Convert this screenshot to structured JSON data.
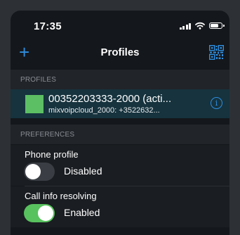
{
  "status_bar": {
    "time": "17:35"
  },
  "nav": {
    "title": "Profiles",
    "add_label": "+"
  },
  "profiles_section": {
    "header": "PROFILES",
    "items": [
      {
        "name": "00352203333-2000 (acti...",
        "subtitle": "mixvoipcloud_2000: +3522632...",
        "color": "#5cbf63",
        "selected": true
      }
    ]
  },
  "preferences_section": {
    "header": "PREFERENCES",
    "items": [
      {
        "label": "Phone profile",
        "state": "Disabled",
        "enabled": false
      },
      {
        "label": "Call info resolving",
        "state": "Enabled",
        "enabled": true
      }
    ]
  },
  "colors": {
    "accent": "#2f8fe0",
    "toggle_on": "#58c25e",
    "selected_row": "#16333e"
  }
}
